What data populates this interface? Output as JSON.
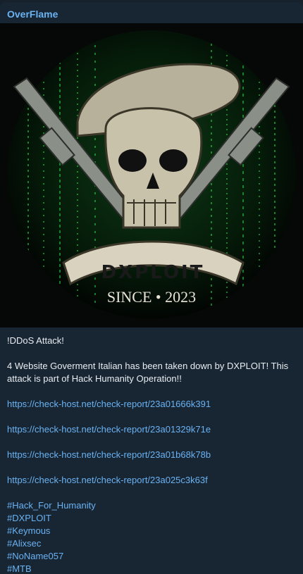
{
  "message": {
    "sender": "OverFlame",
    "image": {
      "banner_text": "DXPLOIT",
      "since_text": "SINCE • 2023"
    },
    "lines": {
      "title": "!DDoS Attack!",
      "body": "4 Website Goverment Italian has been taken down by DXPLOIT! This attack is part of Hack Humanity Operation!!"
    },
    "links": [
      "https://check-host.net/check-report/23a01666k391",
      "https://check-host.net/check-report/23a01329k71e",
      "https://check-host.net/check-report/23a01b68k78b",
      "https://check-host.net/check-report/23a025c3k63f"
    ],
    "hashtags": [
      "#Hack_For_Humanity",
      "#DXPLOIT",
      "#Keymous",
      "#Alixsec",
      "#NoName057",
      "#MTB"
    ]
  },
  "colors": {
    "bubble": "#182533",
    "accent": "#6ab3f3",
    "text": "#e8edf2"
  }
}
